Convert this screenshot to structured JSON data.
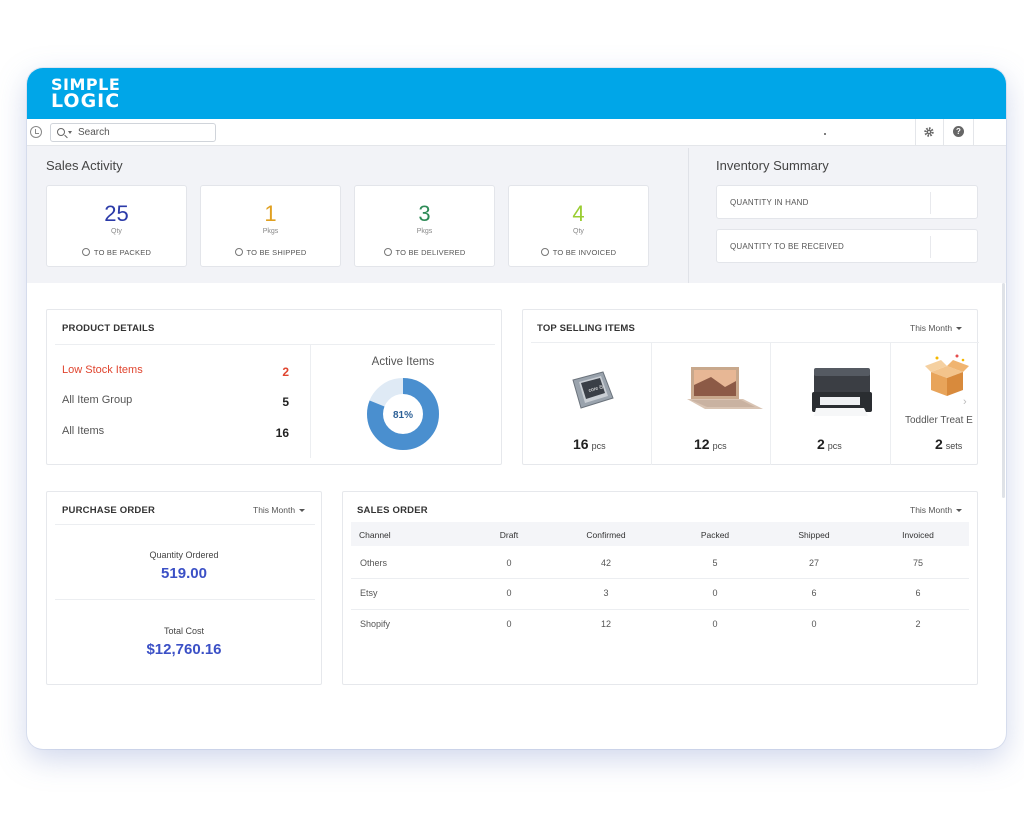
{
  "brand": {
    "line1": "SIMPLE",
    "line2": "LOGIC",
    "color": "#00a6e8"
  },
  "toolbar": {
    "search_placeholder": "Search",
    "history_icon": "history-icon",
    "settings_icon": "gear-icon",
    "help_icon": "help-icon"
  },
  "sales_activity": {
    "title": "Sales Activity",
    "cards": [
      {
        "value": "25",
        "unit": "Qty",
        "label": "TO BE PACKED",
        "color": "#2b3aa8"
      },
      {
        "value": "1",
        "unit": "Pkgs",
        "label": "TO BE SHIPPED",
        "color": "#e0a020"
      },
      {
        "value": "3",
        "unit": "Pkgs",
        "label": "TO BE DELIVERED",
        "color": "#2e8b57"
      },
      {
        "value": "4",
        "unit": "Qty",
        "label": "TO BE INVOICED",
        "color": "#9acd32"
      }
    ]
  },
  "inventory_summary": {
    "title": "Inventory Summary",
    "rows": [
      {
        "label": "QUANTITY IN HAND"
      },
      {
        "label": "QUANTITY TO BE RECEIVED"
      }
    ]
  },
  "product_details": {
    "title": "PRODUCT DETAILS",
    "rows": [
      {
        "label": "Low Stock Items",
        "value": "2",
        "color": "#e0452f"
      },
      {
        "label": "All Item Group",
        "value": "5"
      },
      {
        "label": "All Items",
        "value": "16"
      }
    ],
    "active_items": {
      "title": "Active Items",
      "percent_label": "81%",
      "percent": 81
    }
  },
  "top_selling": {
    "title": "TOP SELLING ITEMS",
    "period": "This Month",
    "items": [
      {
        "image": "cpu-chip-icon",
        "qty": "16",
        "unit": "pcs",
        "name": ""
      },
      {
        "image": "laptop-icon",
        "qty": "12",
        "unit": "pcs",
        "name": ""
      },
      {
        "image": "printer-icon",
        "qty": "2",
        "unit": "pcs",
        "name": ""
      },
      {
        "image": "gift-box-icon",
        "qty": "2",
        "unit": "sets",
        "name": "Toddler Treat E"
      }
    ]
  },
  "purchase_order": {
    "title": "PURCHASE ORDER",
    "period": "This Month",
    "quantity_label": "Quantity Ordered",
    "quantity_value": "519.00",
    "cost_label": "Total Cost",
    "cost_value": "$12,760.16"
  },
  "sales_order": {
    "title": "SALES ORDER",
    "period": "This Month",
    "headers": [
      "Channel",
      "Draft",
      "Confirmed",
      "Packed",
      "Shipped",
      "Invoiced"
    ],
    "rows": [
      [
        "Others",
        "0",
        "42",
        "5",
        "27",
        "75"
      ],
      [
        "Etsy",
        "0",
        "3",
        "0",
        "6",
        "6"
      ],
      [
        "Shopify",
        "0",
        "12",
        "0",
        "0",
        "2"
      ]
    ]
  }
}
